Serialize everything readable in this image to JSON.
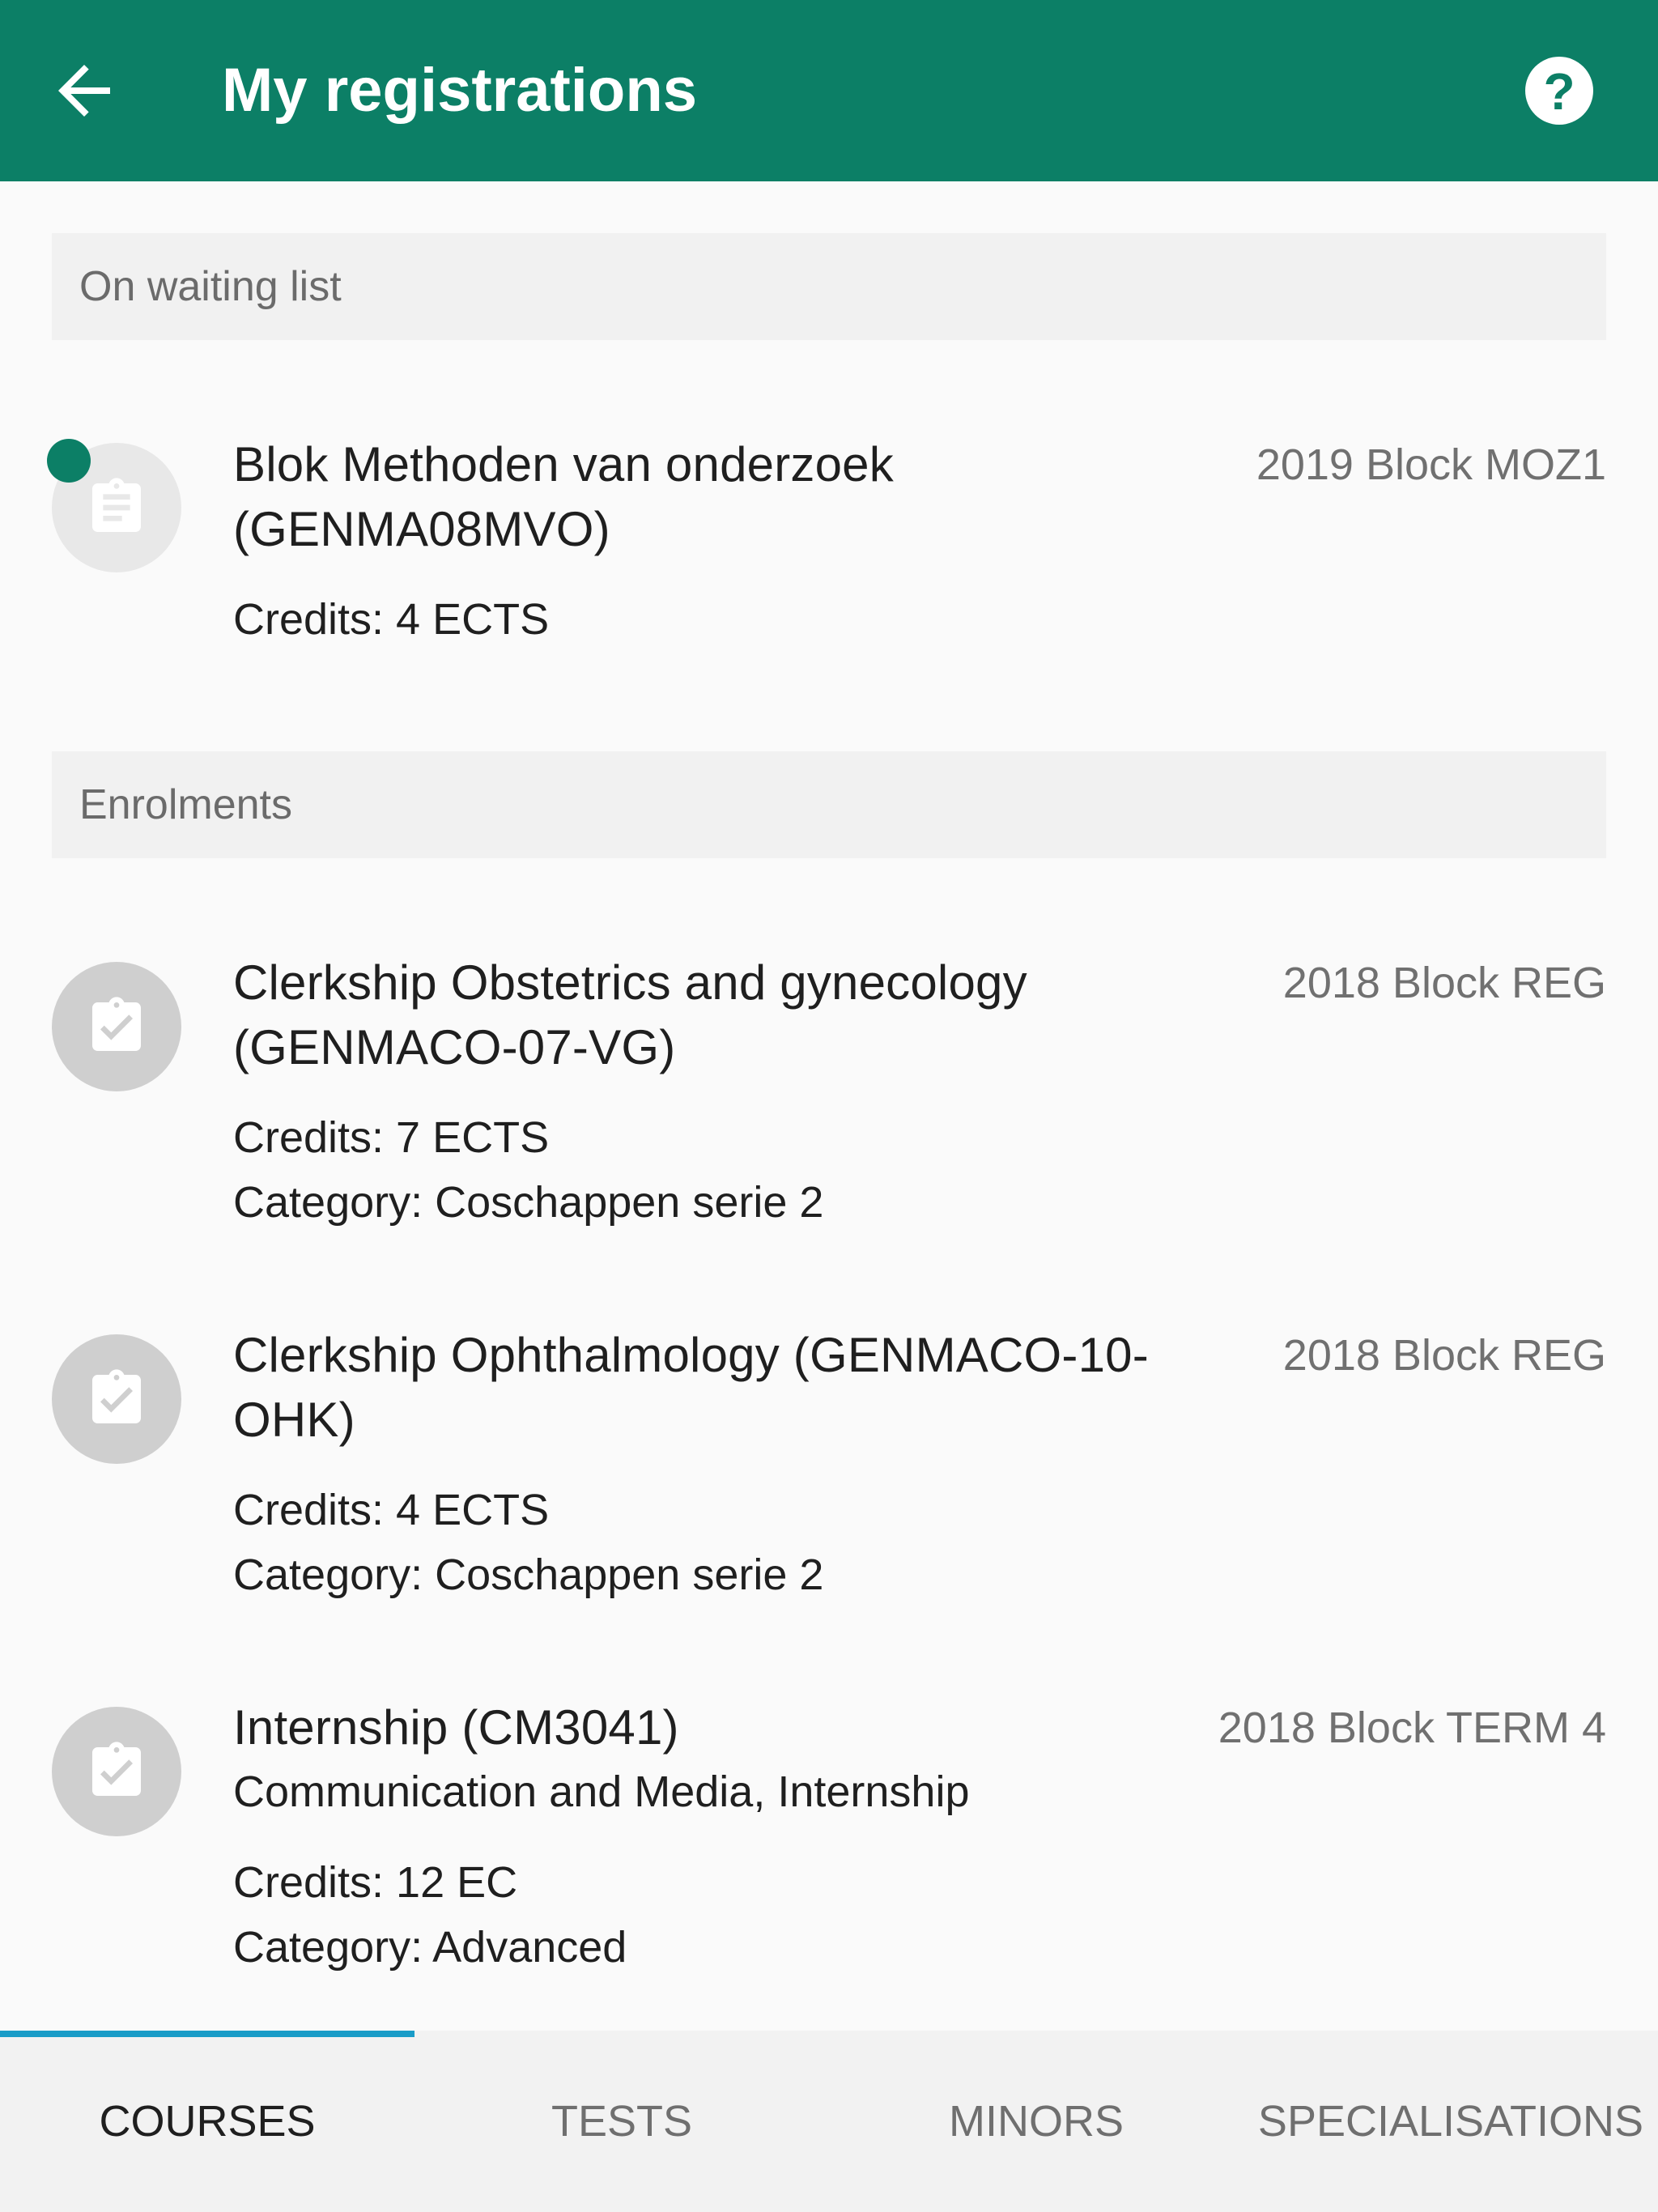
{
  "app_bar": {
    "title": "My registrations",
    "back_icon": "arrow-left-icon",
    "help_icon": "help-circle-icon",
    "help_glyph": "?"
  },
  "colors": {
    "primary": "#0c7f66",
    "tab_indicator": "#1a9cc8",
    "section_bg": "#f1f1f1",
    "avatar_waiting": "#e8e8e8",
    "avatar_enrolled": "#cfcfcf"
  },
  "sections": {
    "waiting": {
      "label": "On waiting list",
      "items": [
        {
          "title_line1": "Blok Methoden van onderzoek",
          "title_line2": "(GENMA08MVO)",
          "period": "2019 Block MOZ1",
          "credits": "Credits: 4 ECTS",
          "icon": "clipboard-list-icon",
          "status": "unread-indicator"
        }
      ]
    },
    "enrolments": {
      "label": "Enrolments",
      "items": [
        {
          "title_line1": "Clerkship Obstetrics and gynecology",
          "title_line2": "(GENMACO-07-VG)",
          "period": "2018 Block REG",
          "credits": "Credits: 7 ECTS",
          "category": "Category: Coschappen serie 2",
          "icon": "clipboard-check-icon"
        },
        {
          "title_line1": "Clerkship Ophthalmology (GENMACO-10-",
          "title_line2": "OHK)",
          "period": "2018 Block REG",
          "credits": "Credits: 4 ECTS",
          "category": "Category: Coschappen serie 2",
          "icon": "clipboard-check-icon"
        },
        {
          "title_line1": "Internship (CM3041)",
          "subtitle": "Communication and Media, Internship",
          "period": "2018 Block TERM 4",
          "credits": "Credits: 12 EC",
          "category": "Category: Advanced",
          "icon": "clipboard-check-icon"
        }
      ]
    }
  },
  "tabs": [
    {
      "label": "COURSES",
      "active": true
    },
    {
      "label": "TESTS",
      "active": false
    },
    {
      "label": "MINORS",
      "active": false
    },
    {
      "label": "SPECIALISATIONS",
      "active": false
    }
  ]
}
